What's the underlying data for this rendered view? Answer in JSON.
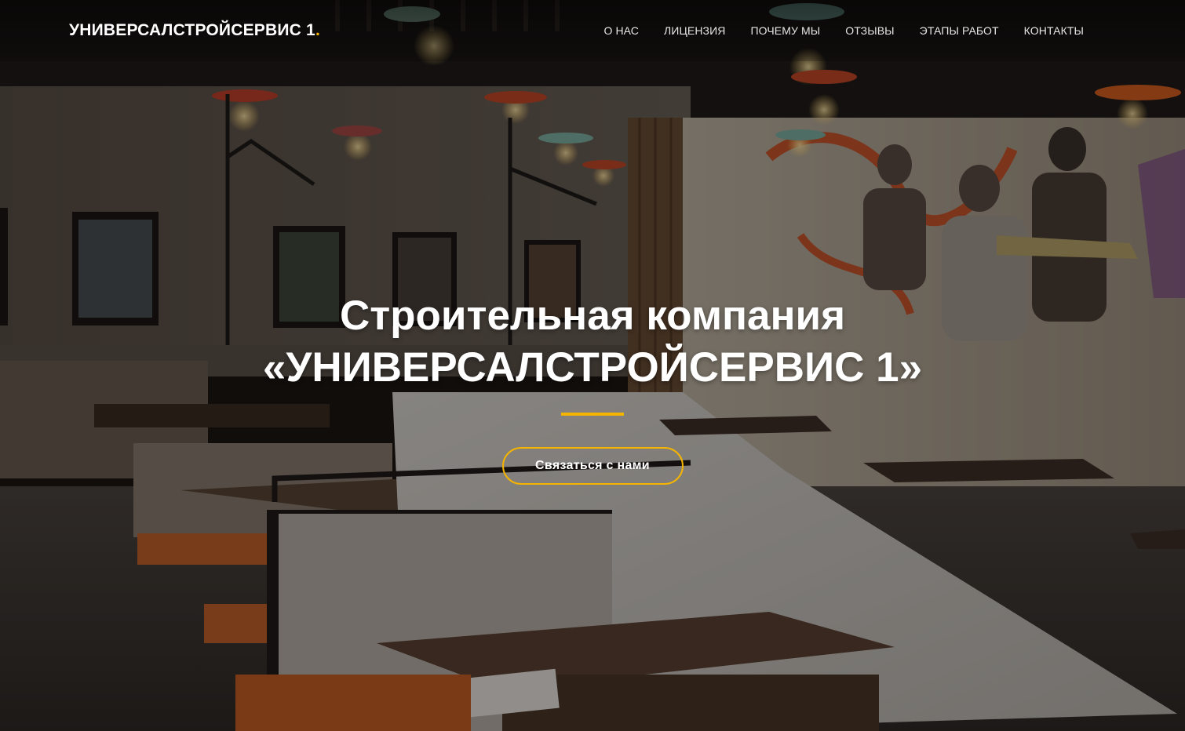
{
  "brand": {
    "name": "УНИВЕРСАЛСТРОЙСЕРВИС 1",
    "dot": "."
  },
  "nav": {
    "items": [
      {
        "label": "О НАС"
      },
      {
        "label": "ЛИЦЕНЗИЯ"
      },
      {
        "label": "ПОЧЕМУ МЫ"
      },
      {
        "label": "ОТЗЫВЫ"
      },
      {
        "label": "ЭТАПЫ РАБОТ"
      },
      {
        "label": "КОНТАКТЫ"
      }
    ]
  },
  "hero": {
    "title_line1": "Строительная компания",
    "title_line2": "«УНИВЕРСАЛСТРОЙСЕРВИС 1»",
    "cta_label": "Связаться с нами"
  },
  "colors": {
    "accent": "#f4b400",
    "text": "#ffffff"
  }
}
